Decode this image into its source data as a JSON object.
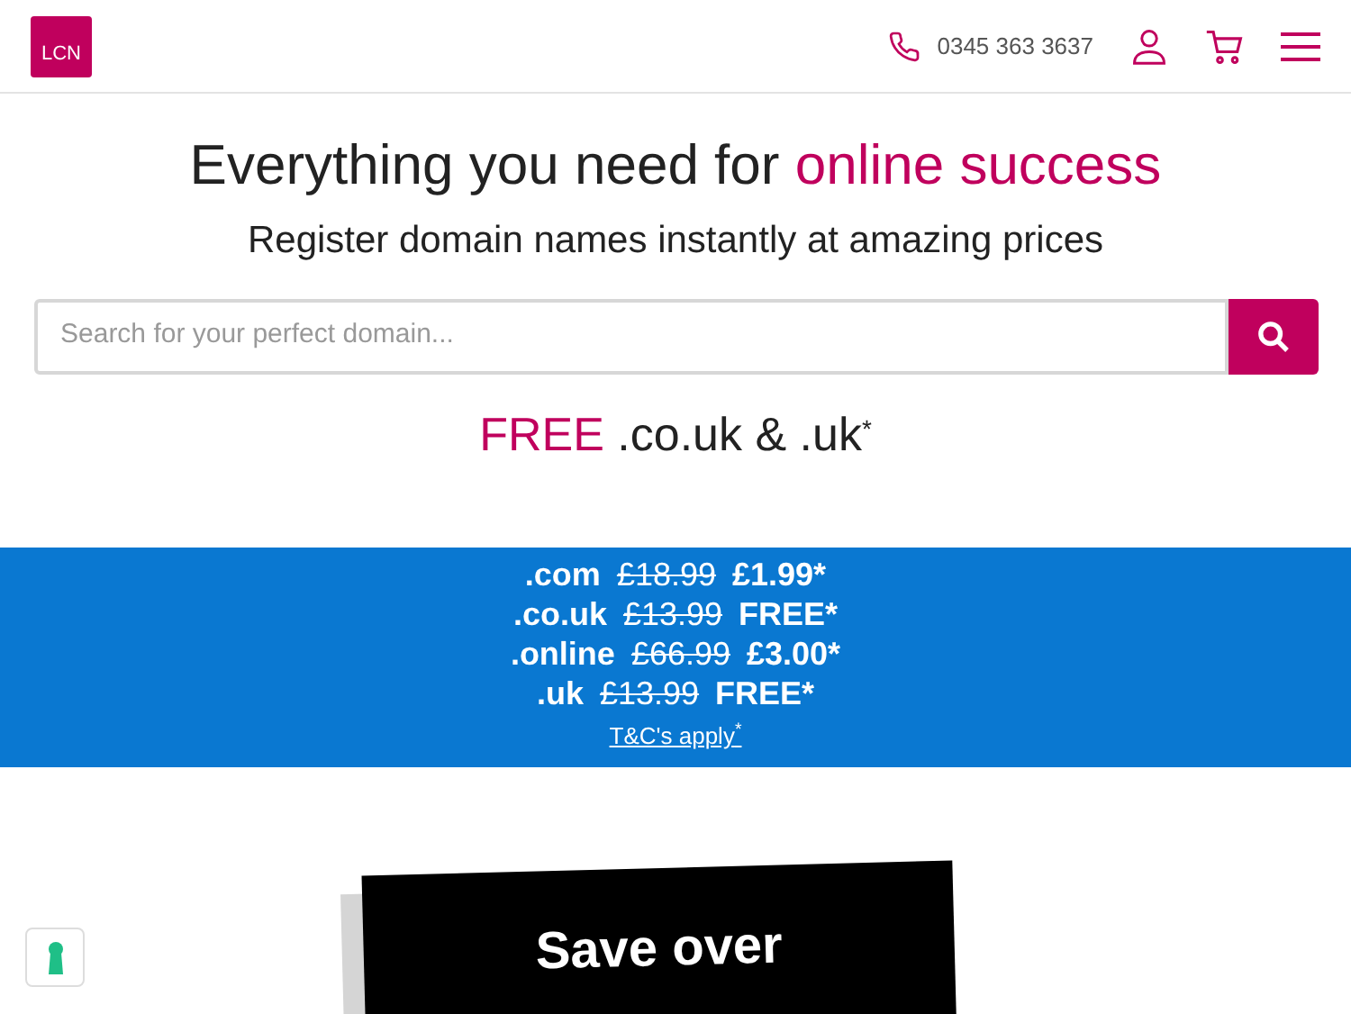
{
  "header": {
    "logo": "LCN",
    "phone": "0345 363 3637"
  },
  "hero": {
    "title_start": "Everything you need for ",
    "title_highlight": "online success",
    "subtitle": "Register domain names instantly at amazing prices",
    "search": {
      "placeholder": "Search for your perfect domain..."
    },
    "offer_highlight": "FREE",
    "offer_rest": " .co.uk & .uk",
    "offer_mark": "*"
  },
  "prices": [
    {
      "ext": ".com",
      "old": "£18.99",
      "new": "£1.99*"
    },
    {
      "ext": ".co.uk",
      "old": "£13.99",
      "new": "FREE*"
    },
    {
      "ext": ".online",
      "old": "£66.99",
      "new": "£3.00*"
    },
    {
      "ext": ".uk",
      "old": "£13.99",
      "new": "FREE*"
    }
  ],
  "terms_link": "T&C's apply",
  "terms_mark": "*",
  "promo": {
    "text": "Save over"
  }
}
